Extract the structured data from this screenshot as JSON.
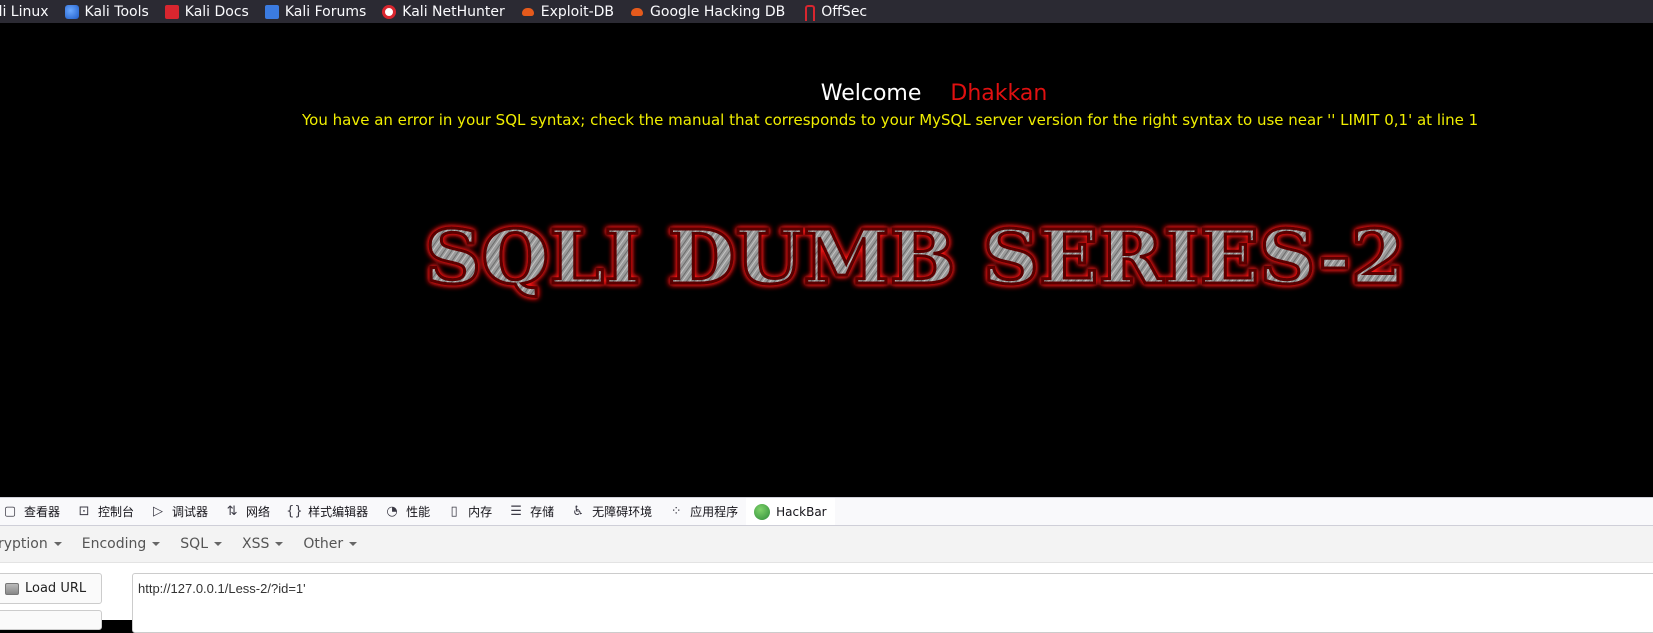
{
  "bookmarks": [
    {
      "label": "ali Linux",
      "icon": "kali-linux-icon"
    },
    {
      "label": "Kali Tools",
      "icon": "kali-tools-icon"
    },
    {
      "label": "Kali Docs",
      "icon": "kali-docs-icon"
    },
    {
      "label": "Kali Forums",
      "icon": "kali-forums-icon"
    },
    {
      "label": "Kali NetHunter",
      "icon": "kali-nethunter-icon"
    },
    {
      "label": "Exploit-DB",
      "icon": "exploit-db-icon"
    },
    {
      "label": "Google Hacking DB",
      "icon": "google-hacking-db-icon"
    },
    {
      "label": "OffSec",
      "icon": "offsec-icon"
    }
  ],
  "page": {
    "welcome_label": "Welcome",
    "welcome_name": "Dhakkan",
    "sql_error": "You have an error in your SQL syntax; check the manual that corresponds to your MySQL server version for the right syntax to use near '' LIMIT 0,1' at line 1",
    "banner_text": "SQLI DUMB SERIES-2"
  },
  "devtools": {
    "tabs": [
      {
        "label": "查看器",
        "icon": "inspector-icon"
      },
      {
        "label": "控制台",
        "icon": "console-icon"
      },
      {
        "label": "调试器",
        "icon": "debugger-icon"
      },
      {
        "label": "网络",
        "icon": "network-icon"
      },
      {
        "label": "样式编辑器",
        "icon": "style-editor-icon"
      },
      {
        "label": "性能",
        "icon": "performance-icon"
      },
      {
        "label": "内存",
        "icon": "memory-icon"
      },
      {
        "label": "存储",
        "icon": "storage-icon"
      },
      {
        "label": "无障碍环境",
        "icon": "accessibility-icon"
      },
      {
        "label": "应用程序",
        "icon": "application-icon"
      },
      {
        "label": "HackBar",
        "icon": "hackbar-icon"
      }
    ],
    "active_tab": "HackBar"
  },
  "hackbar": {
    "menus": [
      "ryption",
      "Encoding",
      "SQL",
      "XSS",
      "Other"
    ],
    "load_url_label": "Load URL",
    "url_value": "http://127.0.0.1/Less-2/?id=1'"
  },
  "colors": {
    "welcome_name": "#e01010",
    "sql_error": "#f0ee00",
    "active_tab_accent": "#0061e0"
  }
}
